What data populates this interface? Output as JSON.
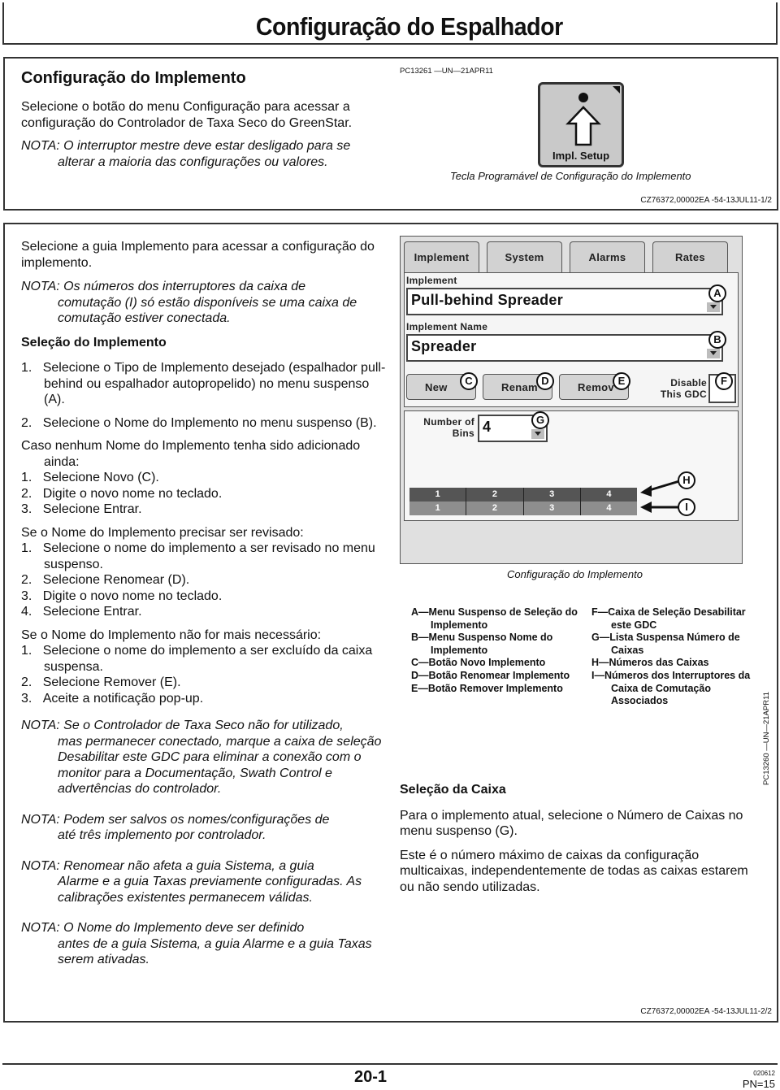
{
  "page": {
    "title": "Configuração do Espalhador",
    "page_number": "20-1",
    "date_code": "020612",
    "pn": "PN=15"
  },
  "section1": {
    "heading": "Configuração do Implemento",
    "paragraph": "Selecione o botão do menu Configuração para acessar a configuração do Controlador de Taxa Seco do GreenStar.",
    "note_label": "NOTA: O interruptor mestre deve estar desligado para se",
    "note_cont": "alterar a maioria das configurações ou valores.",
    "figure_code": "PC13261 —UN—21APR11",
    "softkey_label": "Impl. Setup",
    "softkey_icon": "upload-arrow-icon",
    "figure_caption": "Tecla Programável de Configuração do Implemento",
    "ref": "CZ76372,00002EA -54-13JUL11-1/2"
  },
  "section2": {
    "intro": "Selecione a guia Implemento para acessar a configuração do implemento.",
    "note1_first": "NOTA: Os números dos interruptores da caixa de",
    "note1_rest": "comutação (I) só estão disponíveis se uma caixa de comutação estiver conectada.",
    "heading_selection": "Seleção do Implemento",
    "steps_main": [
      {
        "n": "1.",
        "text": "Selecione o Tipo de Implemento desejado (espalhador pull-behind ou espalhador autopropelido) no menu suspenso (A)."
      },
      {
        "n": "2.",
        "text": "Selecione o Nome do Implemento no menu suspenso (B)."
      }
    ],
    "case_new_intro": "Caso nenhum Nome do Implemento tenha sido adicionado ainda:",
    "steps_new": [
      {
        "n": "1.",
        "text": "Selecione Novo (C)."
      },
      {
        "n": "2.",
        "text": "Digite o novo nome no teclado."
      },
      {
        "n": "3.",
        "text": "Selecione Entrar."
      }
    ],
    "case_rename_intro": "Se o Nome do Implemento precisar ser revisado:",
    "steps_rename": [
      {
        "n": "1.",
        "text": "Selecione o nome do implemento a ser revisado no menu suspenso."
      },
      {
        "n": "2.",
        "text": "Selecione Renomear (D)."
      },
      {
        "n": "3.",
        "text": "Digite o novo nome no teclado."
      },
      {
        "n": "4.",
        "text": "Selecione Entrar."
      }
    ],
    "case_remove_intro": "Se o Nome do Implemento não for mais necessário:",
    "steps_remove": [
      {
        "n": "1.",
        "text": "Selecione o nome do implemento a ser excluído da caixa suspensa."
      },
      {
        "n": "2.",
        "text": "Selecione Remover (E)."
      },
      {
        "n": "3.",
        "text": "Aceite a notificação pop-up."
      }
    ],
    "notes": [
      {
        "first": "NOTA: Se o Controlador de Taxa Seco não for utilizado,",
        "rest": "mas permanecer conectado, marque a caixa de seleção Desabilitar este GDC para eliminar a conexão com o monitor para a Documentação, Swath Control e advertências do controlador."
      },
      {
        "first": "NOTA: Podem ser salvos os nomes/configurações de",
        "rest": "até três implemento por controlador."
      },
      {
        "first": "NOTA: Renomear não afeta a guia Sistema, a guia",
        "rest": "Alarme e a guia Taxas previamente configuradas. As calibrações existentes permanecem válidas."
      },
      {
        "first": "NOTA: O Nome do Implemento deve ser definido",
        "rest": "antes de a guia Sistema, a guia Alarme e a guia Taxas serem ativadas."
      }
    ],
    "screen": {
      "tabs": [
        "Implement",
        "System",
        "Alarms",
        "Rates"
      ],
      "active_tab": "Implement",
      "implement_label": "Implement",
      "implement_value": "Pull-behind Spreader",
      "name_label": "Implement Name",
      "name_value": "Spreader",
      "btn_new": "New",
      "btn_rename": "Renam",
      "btn_remove": "Remov",
      "disable_label_1": "Disable",
      "disable_label_2": "This GDC",
      "disable_checked": false,
      "bins_label_1": "Number of",
      "bins_label_2": "Bins",
      "bins_value": "4",
      "bin_numbers": [
        "1",
        "2",
        "3",
        "4"
      ],
      "switch_numbers": [
        "1",
        "2",
        "3",
        "4"
      ],
      "callouts": [
        "A",
        "B",
        "C",
        "D",
        "E",
        "F",
        "G",
        "H",
        "I"
      ]
    },
    "figure_code": "PC13260 —UN—21APR11",
    "figure_caption": "Configuração do Implemento",
    "legend_left": [
      {
        "key": "A—",
        "text": "Menu Suspenso de Seleção do Implemento"
      },
      {
        "key": "B—",
        "text": "Menu Suspenso Nome do Implemento"
      },
      {
        "key": "C—",
        "text": "Botão Novo Implemento"
      },
      {
        "key": "D—",
        "text": "Botão Renomear Implemento"
      },
      {
        "key": "E—",
        "text": "Botão Remover Implemento"
      }
    ],
    "legend_right": [
      {
        "key": "F—",
        "text": "Caixa de Seleção Desabilitar este GDC"
      },
      {
        "key": "G—",
        "text": "Lista Suspensa Número de Caixas"
      },
      {
        "key": "H—",
        "text": "Números das Caixas"
      },
      {
        "key": "I—",
        "text": "Números dos Interruptores da Caixa de Comutação Associados"
      }
    ],
    "bin_heading": "Seleção da Caixa",
    "bin_p1": "Para o implemento atual, selecione o Número de Caixas no menu suspenso (G).",
    "bin_p2": "Este é o número máximo de caixas da configuração multicaixas, independentemente de todas as caixas estarem ou não sendo utilizadas.",
    "ref": "CZ76372,00002EA -54-13JUL11-2/2"
  }
}
